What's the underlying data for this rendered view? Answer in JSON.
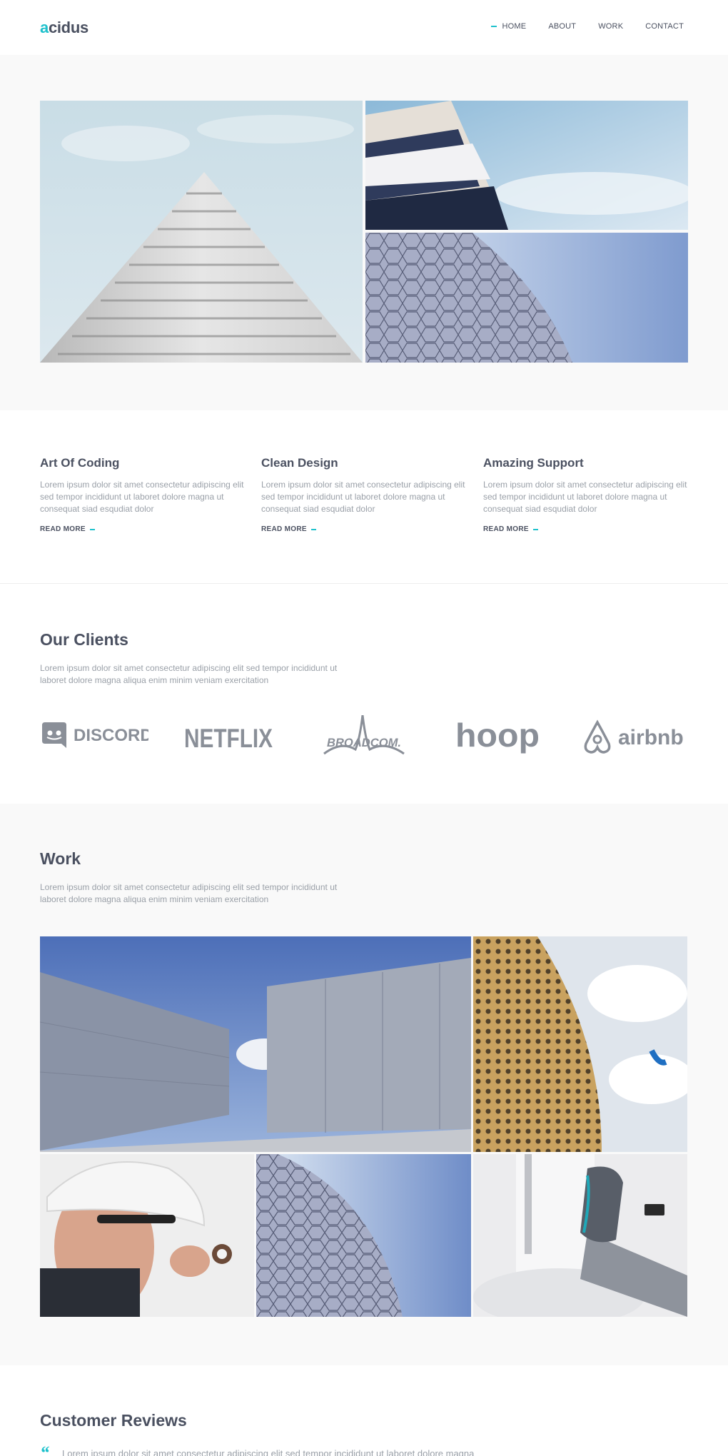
{
  "header": {
    "logo_accent": "a",
    "logo_rest": "cidus",
    "nav": [
      {
        "label": "HOME",
        "active": true
      },
      {
        "label": "ABOUT",
        "active": false
      },
      {
        "label": "WORK",
        "active": false
      },
      {
        "label": "CONTACT",
        "active": false
      }
    ]
  },
  "features": [
    {
      "title": "Art Of Coding",
      "text": "Lorem ipsum dolor sit amet consectetur adipiscing elit sed tempor incididunt ut laboret dolore magna ut consequat siad esqudiat dolor",
      "link": "READ MORE"
    },
    {
      "title": "Clean Design",
      "text": "Lorem ipsum dolor sit amet consectetur adipiscing elit sed tempor incididunt ut laboret dolore magna ut consequat siad esqudiat dolor",
      "link": "READ MORE"
    },
    {
      "title": "Amazing Support",
      "text": "Lorem ipsum dolor sit amet consectetur adipiscing elit sed tempor incididunt ut laboret dolore magna ut consequat siad esqudiat dolor",
      "link": "READ MORE"
    }
  ],
  "clients": {
    "title": "Our Clients",
    "desc": "Lorem ipsum dolor sit amet consectetur adipiscing elit sed tempor incididunt ut laboret dolore magna aliqua enim minim veniam exercitation",
    "logos": [
      "DISCORD",
      "NETFLIX",
      "BROADCOM.",
      "hoop",
      "airbnb"
    ]
  },
  "work": {
    "title": "Work",
    "desc": "Lorem ipsum dolor sit amet consectetur adipiscing elit sed tempor incididunt ut laboret dolore magna aliqua enim minim veniam exercitation"
  },
  "reviews": {
    "title": "Customer Reviews",
    "quote_mark": "“",
    "text": "Lorem ipsum dolor sit amet consectetur adipiscing elit sed tempor incididunt ut laboret dolore magna"
  },
  "colors": {
    "accent": "#1ec1cc",
    "heading": "#4a5060",
    "body": "#9aa0a8",
    "section_bg": "#f9f9f9"
  }
}
